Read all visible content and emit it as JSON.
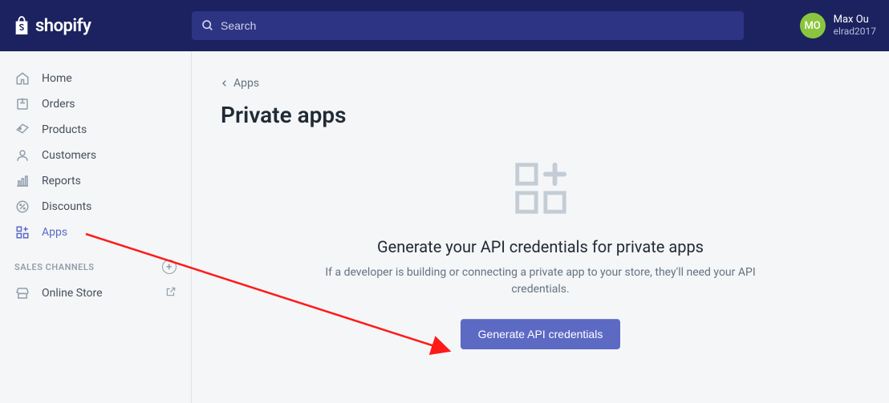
{
  "brand": {
    "name": "shopify"
  },
  "search": {
    "placeholder": "Search"
  },
  "profile": {
    "initials": "MO",
    "name": "Max Ou",
    "store": "elrad2017"
  },
  "sidebar": {
    "items": [
      {
        "label": "Home"
      },
      {
        "label": "Orders"
      },
      {
        "label": "Products"
      },
      {
        "label": "Customers"
      },
      {
        "label": "Reports"
      },
      {
        "label": "Discounts"
      },
      {
        "label": "Apps"
      }
    ],
    "section_label": "SALES CHANNELS",
    "channels": [
      {
        "label": "Online Store"
      }
    ]
  },
  "breadcrumb": {
    "label": "Apps"
  },
  "page": {
    "title": "Private apps",
    "empty_heading": "Generate your API credentials for private apps",
    "empty_desc": "If a developer is building or connecting a private app to your store, they'll need your API credentials.",
    "button_label": "Generate API credentials"
  }
}
